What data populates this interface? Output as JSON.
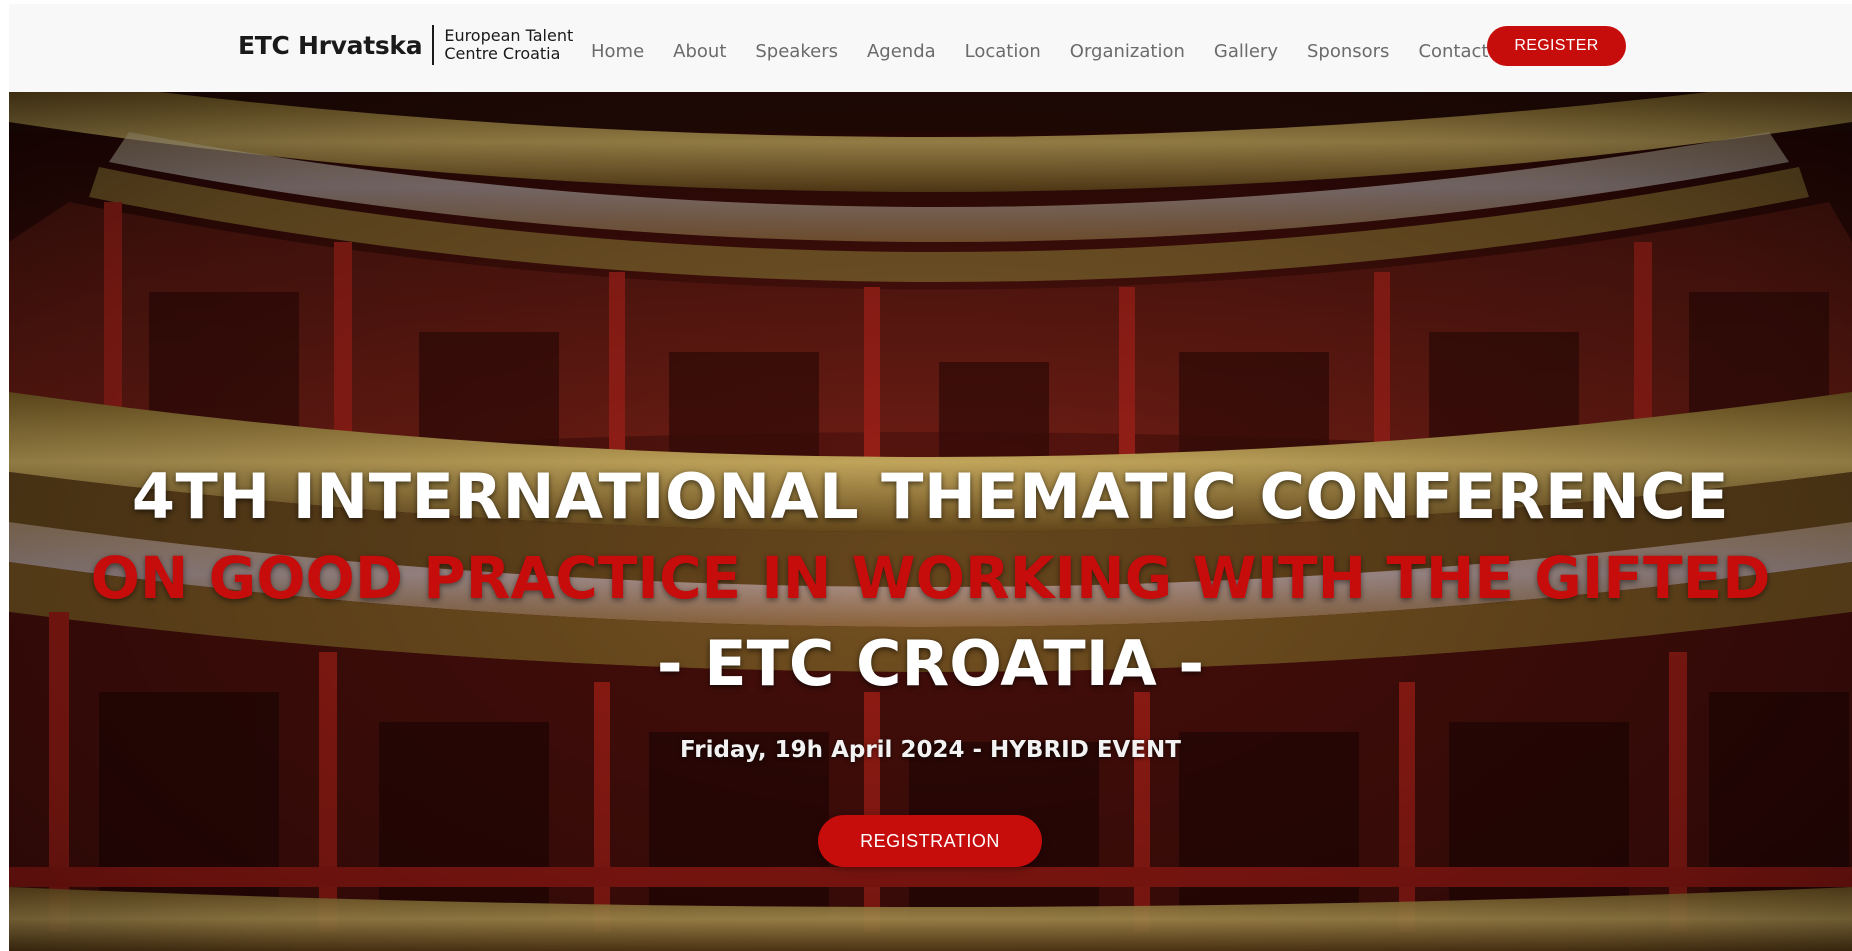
{
  "header": {
    "logo_main": "ETC Hrvatska",
    "logo_sub_line1": "European Talent",
    "logo_sub_line2": "Centre Croatia",
    "nav": [
      {
        "label": "Home"
      },
      {
        "label": "About"
      },
      {
        "label": "Speakers"
      },
      {
        "label": "Agenda"
      },
      {
        "label": "Location"
      },
      {
        "label": "Organization"
      },
      {
        "label": "Gallery"
      },
      {
        "label": "Sponsors"
      },
      {
        "label": "Contact"
      }
    ],
    "register_label": "REGISTER"
  },
  "hero": {
    "title_line1": "4TH INTERNATIONAL THEMATIC CONFERENCE",
    "title_line2": "ON GOOD PRACTICE IN WORKING WITH THE GIFTED",
    "title_line3": "- ETC CROATIA -",
    "event_date": "Friday, 19h April 2024 - HYBRID EVENT",
    "register_label": "REGISTRATION"
  },
  "colors": {
    "accent": "#c70c0c",
    "nav_text": "#6b6b6b",
    "header_bg": "#f8f8f8"
  }
}
